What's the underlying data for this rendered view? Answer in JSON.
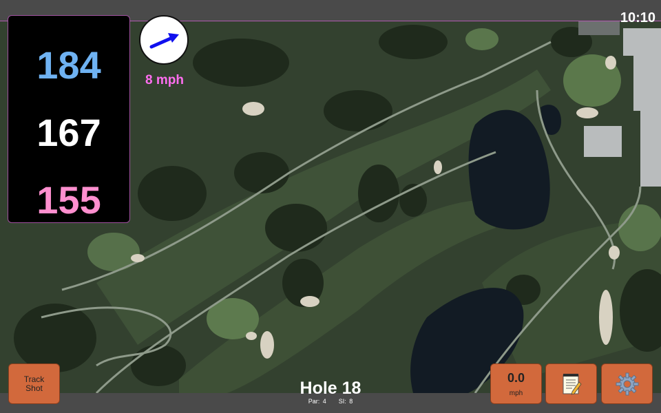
{
  "status": {
    "time": "10:10"
  },
  "distances": {
    "back": "184",
    "middle": "167",
    "front": "155"
  },
  "wind": {
    "speed": "8 mph",
    "icon": "wind-direction-arrow-icon"
  },
  "hole": {
    "title": "Hole 18",
    "par_label": "Par: 4",
    "si_label": "SI: 8"
  },
  "buttons": {
    "track_shot_line1": "Track",
    "track_shot_line2": "Shot",
    "speed_value": "0.0",
    "speed_unit": "mph",
    "notes_icon": "notepad-icon",
    "settings_icon": "gear-icon"
  },
  "colors": {
    "back": "#6fb2f2",
    "middle": "#ffffff",
    "front": "#ff8fcf",
    "wind_text": "#ff6ef0",
    "button": "#d2693c"
  }
}
